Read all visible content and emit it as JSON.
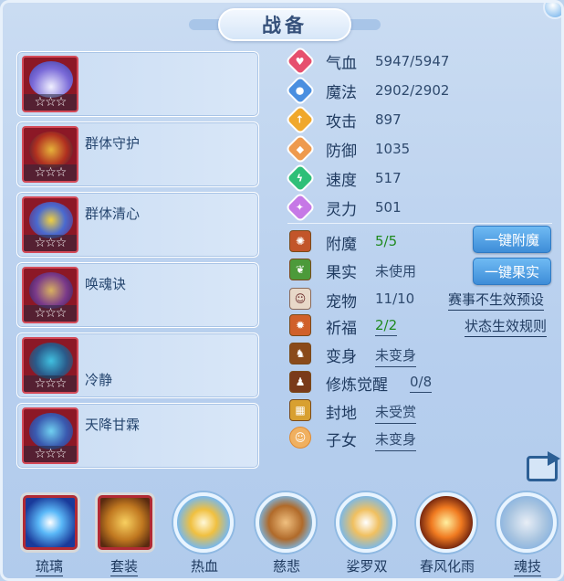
{
  "title": "战备",
  "skills": [
    {
      "name": "",
      "stars": "☆☆☆"
    },
    {
      "name": "群体守护",
      "stars": "☆☆☆"
    },
    {
      "name": "群体清心",
      "stars": "☆☆☆"
    },
    {
      "name": "唤魂诀",
      "stars": "☆☆☆"
    },
    {
      "name": "冷静",
      "stars": "☆☆☆"
    },
    {
      "name": "天降甘霖",
      "stars": "☆☆☆"
    }
  ],
  "stats": [
    {
      "label": "气血",
      "value": "5947/5947",
      "color": "#e6506e",
      "icon": "heart-icon"
    },
    {
      "label": "魔法",
      "value": "2902/2902",
      "color": "#4a8fe0",
      "icon": "mana-icon"
    },
    {
      "label": "攻击",
      "value": "897",
      "color": "#f0a82c",
      "icon": "attack-icon"
    },
    {
      "label": "防御",
      "value": "1035",
      "color": "#ee9a4e",
      "icon": "defense-icon"
    },
    {
      "label": "速度",
      "value": "517",
      "color": "#2ebf78",
      "icon": "speed-icon"
    },
    {
      "label": "灵力",
      "value": "501",
      "color": "#c678e6",
      "icon": "spirit-icon"
    }
  ],
  "attributes": {
    "enchant": {
      "label": "附魔",
      "value": "5/5"
    },
    "fruit": {
      "label": "果实",
      "value": "未使用"
    },
    "pet": {
      "label": "宠物",
      "value": "11/10"
    },
    "blessing": {
      "label": "祈福",
      "value": "2/2"
    },
    "transform": {
      "label": "变身",
      "value": "未变身"
    },
    "cultivation": {
      "label": "修炼觉醒",
      "value": "0/8"
    },
    "fief": {
      "label": "封地",
      "value": "未受赏"
    },
    "child": {
      "label": "子女",
      "value": "未变身"
    }
  },
  "buttons": {
    "one_click_enchant": "一键附魔",
    "one_click_fruit": "一键果实"
  },
  "links": {
    "event_preset": "赛事不生效预设",
    "status_rules": "状态生效规则"
  },
  "bottom_tabs": [
    {
      "label": "琉璃",
      "icon": "crystal-icon"
    },
    {
      "label": "套装",
      "icon": "armor-set-icon"
    },
    {
      "label": "热血",
      "icon": "warrior-icon"
    },
    {
      "label": "慈悲",
      "icon": "scroll-icon"
    },
    {
      "label": "娑罗双",
      "icon": "feather-icon"
    },
    {
      "label": "春风化雨",
      "icon": "burst-icon"
    },
    {
      "label": "魂技",
      "icon": "skull-icon"
    }
  ]
}
